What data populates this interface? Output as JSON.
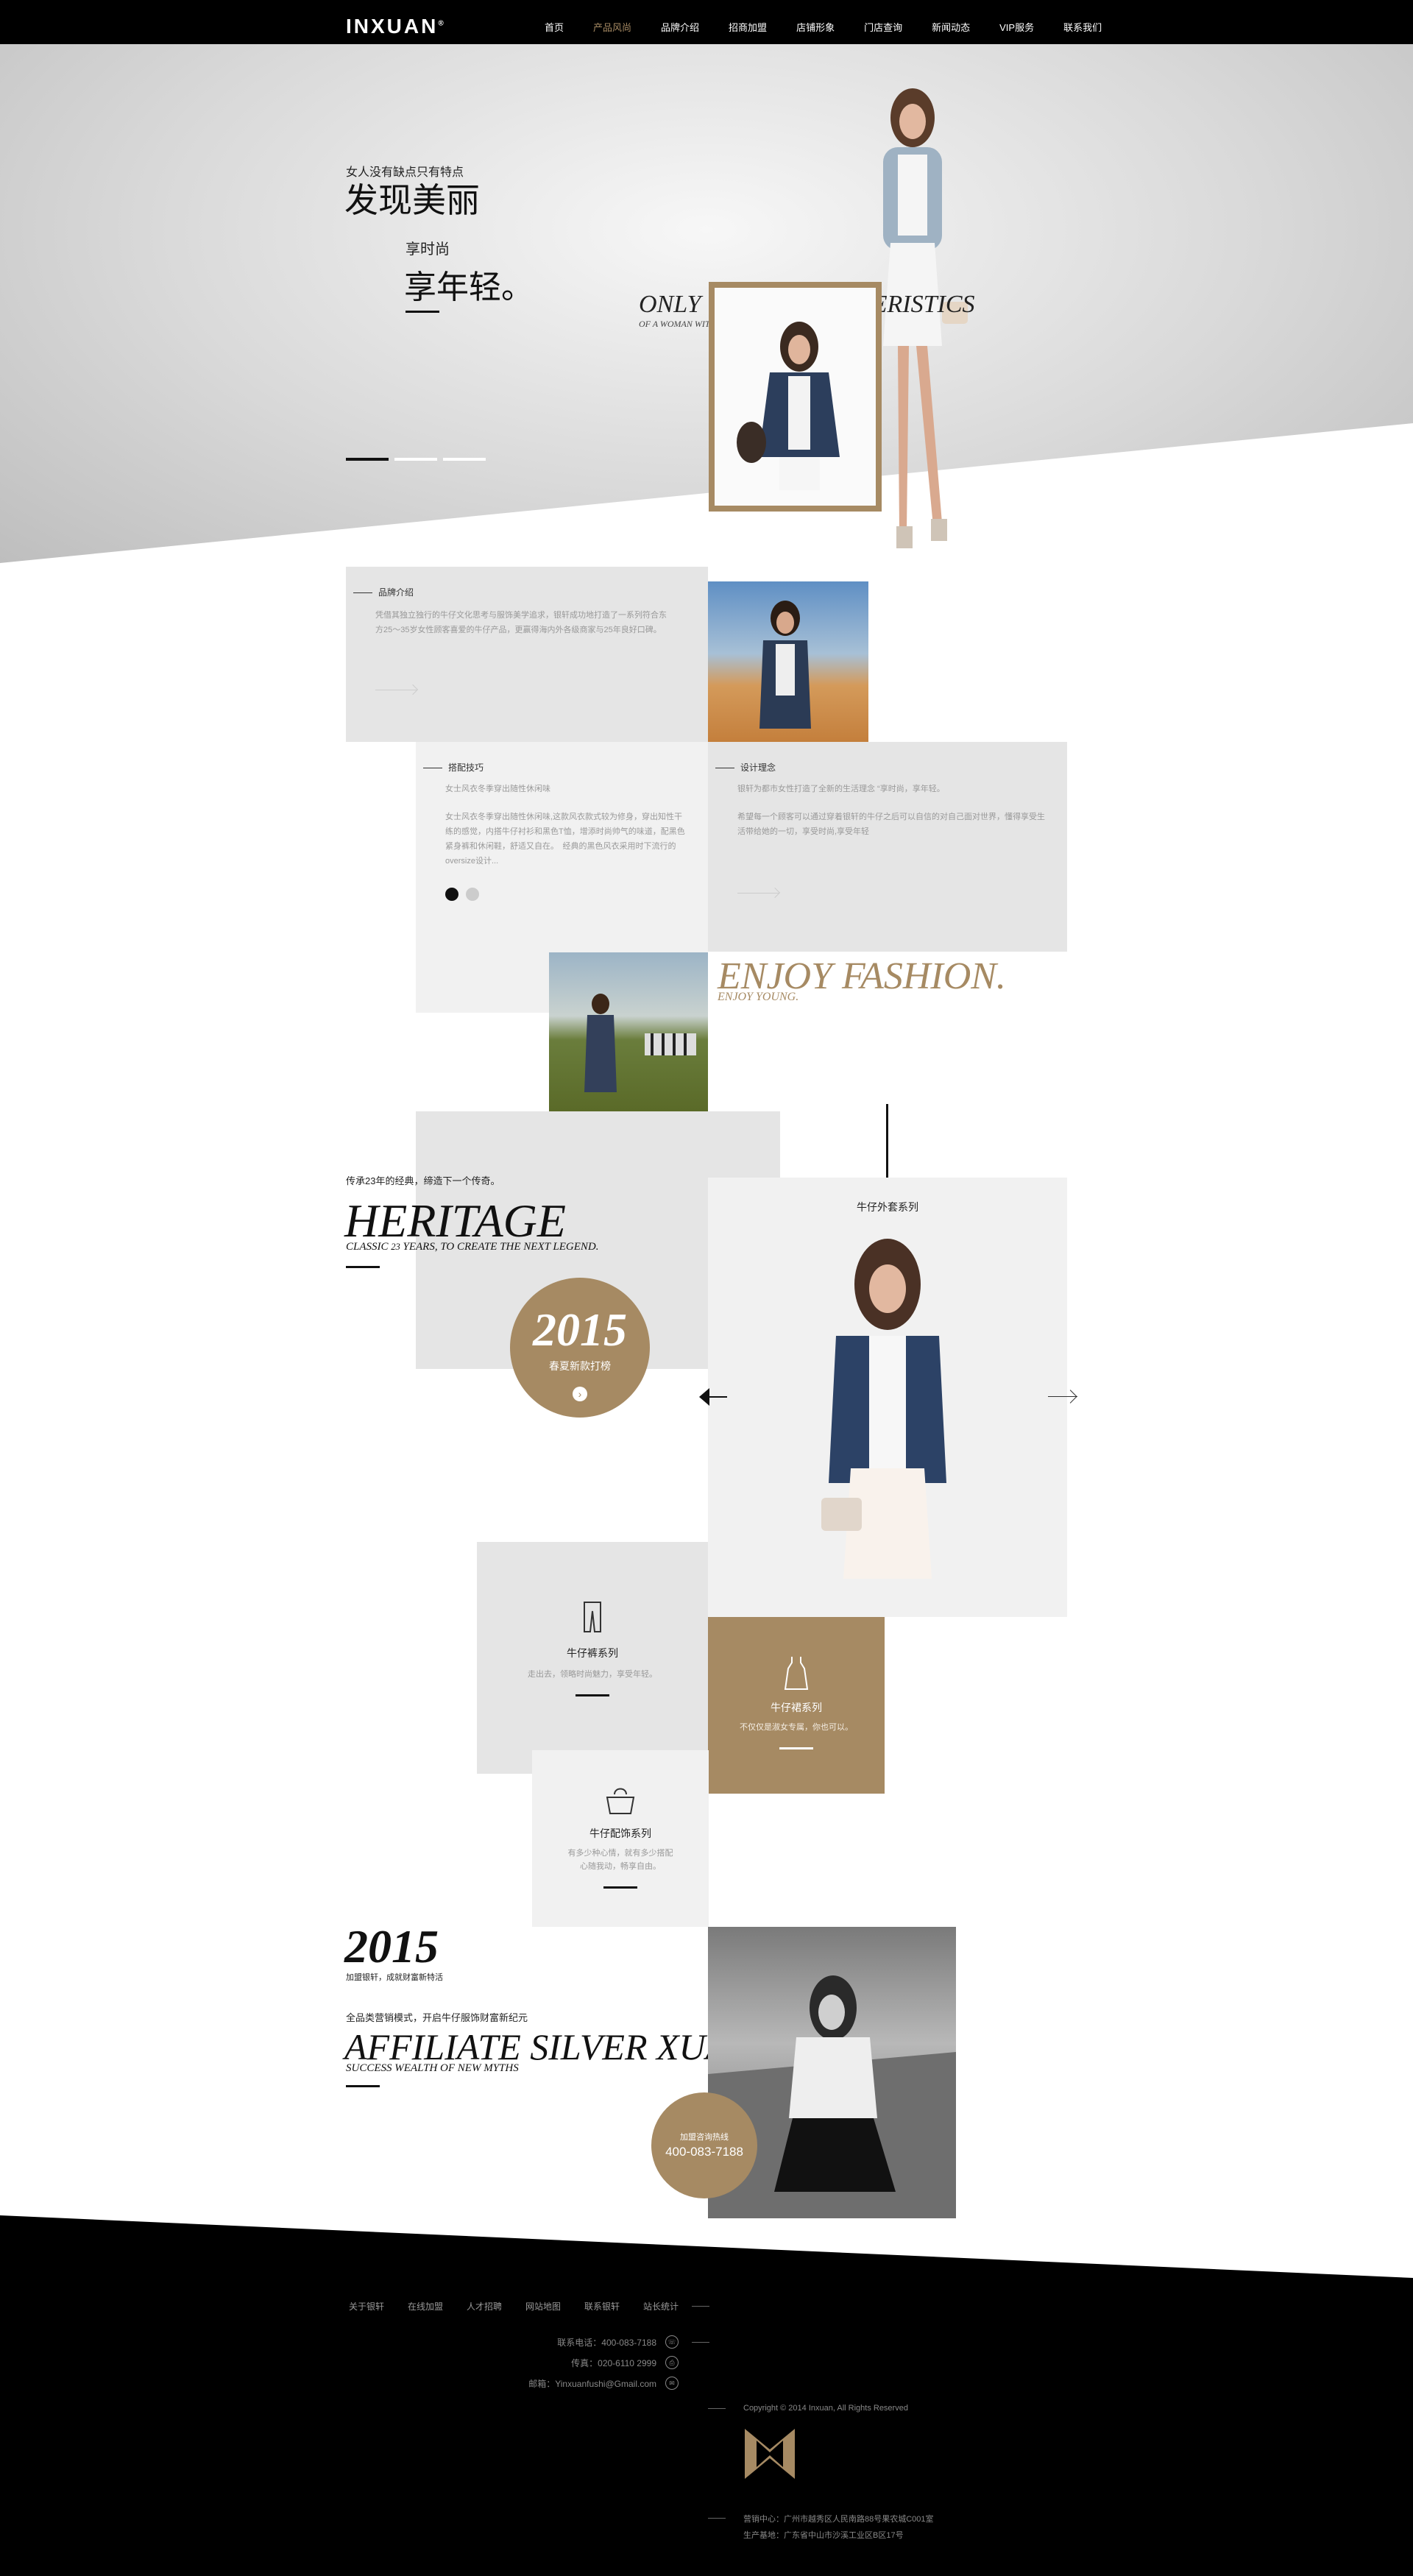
{
  "brand": {
    "logo": "INXUAN",
    "logo_mark": "®"
  },
  "nav": {
    "items": [
      "首页",
      "产品风尚",
      "品牌介绍",
      "招商加盟",
      "店铺形象",
      "门店查询",
      "新闻动态",
      "VIP服务",
      "联系我们"
    ],
    "active": "产品风尚"
  },
  "hero": {
    "small_title": "女人没有缺点只有特点",
    "big_title": "发现美丽",
    "sub_small": "享时尚",
    "sub_big": "享年轻。",
    "overlay_title": "ONLY THE CHARACTERISTICS",
    "overlay_sub": "OF A WOMAN WITHOUT DRAWBACKS",
    "slides": 3,
    "active_slide": 1
  },
  "brand_intro": {
    "title": "品牌介绍",
    "text": "凭借其独立独行的牛仔文化思考与服饰美学追求，银轩成功地打造了一系列符合东方25～35岁女性顾客喜爱的牛仔产品，更赢得海内外各级商家与25年良好口碑。"
  },
  "matching": {
    "title": "搭配技巧",
    "lead": "女士风衣冬季穿出随性休闲味",
    "text": "女士风衣冬季穿出随性休闲味,这款风衣款式较为修身，穿出知性干练的感觉，内搭牛仔衬衫和黑色T恤，增添时尚帅气的味道，配黑色紧身裤和休闲鞋，舒适又自在。　经典的黑色风衣采用时下流行的oversize设计..."
  },
  "design": {
    "title": "设计理念",
    "text1": "银轩为都市女性打造了全新的生活理念 “享时尚，享年轻。",
    "text2": "希望每一个顾客可以通过穿着银轩的牛仔之后可以自信的对自己面对世界，懂得享受生活带给她的一切，享受时尚,享受年轻"
  },
  "enjoy": {
    "title": "ENJOY FASHION.",
    "sub": "ENJOY YOUNG."
  },
  "heritage": {
    "lead": "传承23年的经典，缔造下一个传奇。",
    "title": "HERITAGE",
    "sub_pre": "CLASSIC",
    "sub_num": "23",
    "sub_post": "YEARS, TO CREATE THE NEXT LEGEND.",
    "circle_year": "2015",
    "circle_text": "春夏新款打榜",
    "circle_btn": "›"
  },
  "showcase": {
    "title": "牛仔外套系列",
    "prev": "←",
    "next": "→"
  },
  "series": [
    {
      "title": "牛仔裤系列",
      "text": "走出去，领略时尚魅力，享受年轻。",
      "icon": "jeans-icon"
    },
    {
      "title": "牛仔裙系列",
      "text": "不仅仅是淑女专属，你也可以。",
      "icon": "dress-icon"
    },
    {
      "title": "牛仔配饰系列",
      "text": "有多少种心情，就有多少搭配\n心随我动，畅享自由。",
      "icon": "bag-icon"
    }
  ],
  "affiliate": {
    "year": "2015",
    "year_sub": "加盟银轩，成就财富新特活",
    "lead": "全品类营销模式，开启牛仔服饰财富新纪元",
    "title": "AFFILIATE SILVER XUAN",
    "sub": "SUCCESS WEALTH OF NEW MYTHS",
    "hotline_label": "加盟咨询热线",
    "hotline": "400-083-7188"
  },
  "footer": {
    "links": [
      "关于银轩",
      "在线加盟",
      "人才招聘",
      "网站地图",
      "联系银轩",
      "站长统计"
    ],
    "phone": "联系电话：400-083-7188",
    "fax": "传真：020-6110 2999",
    "email": "邮箱：Yinxuanfushi@Gmail.com",
    "copyright": "Copyright © 2014 Inxuan, All Rights Reserved",
    "marketing": "营销中心：广州市越秀区人民南路88号果农城C001室",
    "production": "生产基地：广东省中山市沙溪工业区B区17号"
  },
  "colors": {
    "accent": "#a68a63",
    "dark": "#000000",
    "panel_gray": "#e5e5e5",
    "panel_light": "#f1f1f1"
  }
}
